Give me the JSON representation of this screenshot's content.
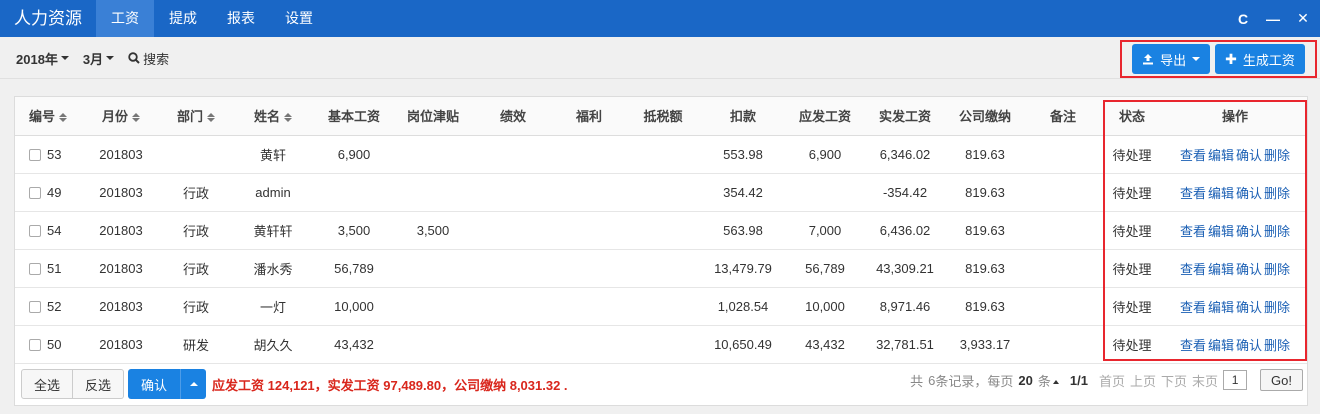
{
  "app": {
    "title": "人力资源"
  },
  "nav": {
    "tabs": [
      "工资",
      "提成",
      "报表",
      "设置"
    ]
  },
  "window": {
    "refresh": "C",
    "minimize": "—",
    "close": "✕"
  },
  "toolbar": {
    "year": "2018年",
    "month": "3月",
    "search": "搜索",
    "export": "导出",
    "generate": "生成工资"
  },
  "table": {
    "headers": {
      "id": "编号",
      "month": "月份",
      "dept": "部门",
      "name": "姓名",
      "base": "基本工资",
      "allowance": "岗位津贴",
      "perf": "绩效",
      "welfare": "福利",
      "tax_free": "抵税额",
      "deduct": "扣款",
      "gross": "应发工资",
      "net": "实发工资",
      "company": "公司缴纳",
      "note": "备注",
      "status": "状态",
      "ops": "操作"
    },
    "op_labels": {
      "view": "查看",
      "edit": "编辑",
      "confirm": "确认",
      "delete": "删除"
    },
    "rows": [
      {
        "id": "53",
        "month": "201803",
        "dept": "",
        "name": "黄轩",
        "base": "6,900",
        "allowance": "",
        "perf": "",
        "welfare": "",
        "tax_free": "",
        "deduct": "553.98",
        "gross": "6,900",
        "net": "6,346.02",
        "company": "819.63",
        "note": "",
        "status": "待处理"
      },
      {
        "id": "49",
        "month": "201803",
        "dept": "行政",
        "name": "admin",
        "base": "",
        "allowance": "",
        "perf": "",
        "welfare": "",
        "tax_free": "",
        "deduct": "354.42",
        "gross": "",
        "net": "-354.42",
        "company": "819.63",
        "note": "",
        "status": "待处理"
      },
      {
        "id": "54",
        "month": "201803",
        "dept": "行政",
        "name": "黄轩轩",
        "base": "3,500",
        "allowance": "3,500",
        "perf": "",
        "welfare": "",
        "tax_free": "",
        "deduct": "563.98",
        "gross": "7,000",
        "net": "6,436.02",
        "company": "819.63",
        "note": "",
        "status": "待处理"
      },
      {
        "id": "51",
        "month": "201803",
        "dept": "行政",
        "name": "潘水秀",
        "base": "56,789",
        "allowance": "",
        "perf": "",
        "welfare": "",
        "tax_free": "",
        "deduct": "13,479.79",
        "gross": "56,789",
        "net": "43,309.21",
        "company": "819.63",
        "note": "",
        "status": "待处理"
      },
      {
        "id": "52",
        "month": "201803",
        "dept": "行政",
        "name": "一灯",
        "base": "10,000",
        "allowance": "",
        "perf": "",
        "welfare": "",
        "tax_free": "",
        "deduct": "1,028.54",
        "gross": "10,000",
        "net": "8,971.46",
        "company": "819.63",
        "note": "",
        "status": "待处理"
      },
      {
        "id": "50",
        "month": "201803",
        "dept": "研发",
        "name": "胡久久",
        "base": "43,432",
        "allowance": "",
        "perf": "",
        "welfare": "",
        "tax_free": "",
        "deduct": "10,650.49",
        "gross": "43,432",
        "net": "32,781.51",
        "company": "3,933.17",
        "note": "",
        "status": "待处理"
      }
    ]
  },
  "footer": {
    "select_all": "全选",
    "invert": "反选",
    "confirm": "确认",
    "summary": "应发工资 124,121，实发工资 97,489.80，公司缴纳 8,031.32 .",
    "pager": {
      "total_prefix": "共",
      "total": "6",
      "total_suffix": "条记录，每页",
      "per_page": "20",
      "per_page_suffix": "条",
      "page_info": "1/1",
      "first": "首页",
      "prev": "上页",
      "next": "下页",
      "last": "末页",
      "page_value": "1",
      "go": "Go!"
    }
  }
}
